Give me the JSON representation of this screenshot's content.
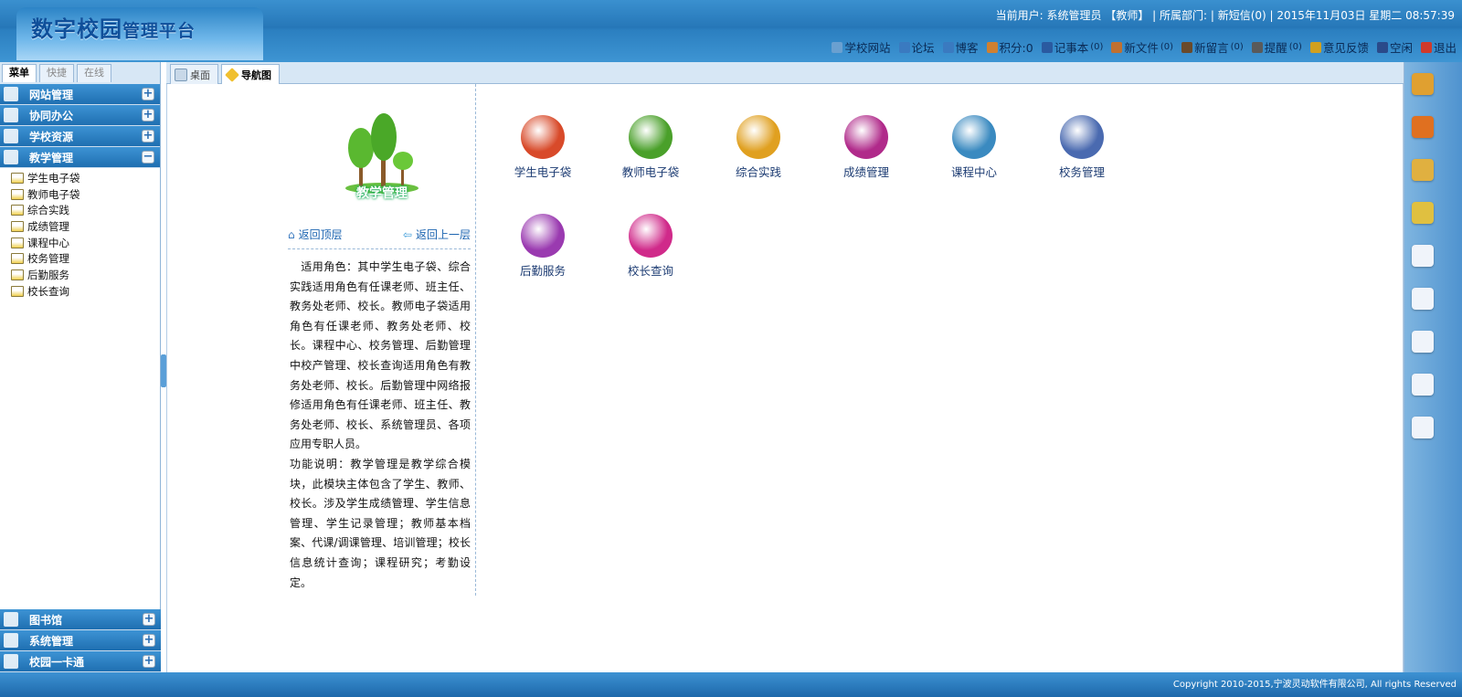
{
  "header": {
    "logo_main": "数字校园",
    "logo_sub": "管理平台",
    "status": "当前用户: 系统管理员 【教师】 | 所属部门: | 新短信(0) | 2015年11月03日 星期二 08:57:39",
    "toolbar": [
      {
        "label": "学校网站",
        "count": "",
        "icon": "monitor-icon",
        "color": "#6aa0d0"
      },
      {
        "label": "论坛",
        "count": "",
        "icon": "forum-icon",
        "color": "#3a7ac0"
      },
      {
        "label": "博客",
        "count": "",
        "icon": "blog-icon",
        "color": "#3a7ac0"
      },
      {
        "label": "积分:0",
        "count": "",
        "icon": "chart-icon",
        "color": "#d08030"
      },
      {
        "label": "记事本",
        "count": "(0)",
        "icon": "notebook-icon",
        "color": "#2a5aa0"
      },
      {
        "label": "新文件",
        "count": "(0)",
        "icon": "file-icon",
        "color": "#c07030"
      },
      {
        "label": "新留言",
        "count": "(0)",
        "icon": "message-icon",
        "color": "#6a4a2a"
      },
      {
        "label": "提醒",
        "count": "(0)",
        "icon": "alert-icon",
        "color": "#5a5a5a"
      },
      {
        "label": "意见反馈",
        "count": "",
        "icon": "feedback-icon",
        "color": "#d0a020"
      },
      {
        "label": "空闲",
        "count": "",
        "icon": "user-status-icon",
        "color": "#2a4a8a"
      },
      {
        "label": "退出",
        "count": "",
        "icon": "logout-icon",
        "color": "#d03a2a"
      }
    ]
  },
  "sidebar": {
    "tabs": [
      "菜单",
      "快捷",
      "在线"
    ],
    "categories_top": [
      {
        "label": "网站管理",
        "toggle": "+"
      },
      {
        "label": "协同办公",
        "toggle": "+"
      },
      {
        "label": "学校资源",
        "toggle": "+"
      },
      {
        "label": "教学管理",
        "toggle": "−"
      }
    ],
    "items": [
      "学生电子袋",
      "教师电子袋",
      "综合实践",
      "成绩管理",
      "课程中心",
      "校务管理",
      "后勤服务",
      "校长查询"
    ],
    "categories_bottom": [
      {
        "label": "图书馆",
        "toggle": "+"
      },
      {
        "label": "系统管理",
        "toggle": "+"
      },
      {
        "label": "校园一卡通",
        "toggle": "+"
      }
    ]
  },
  "tabs": [
    {
      "label": "桌面"
    },
    {
      "label": "导航图"
    }
  ],
  "module": {
    "title": "教学管理",
    "nav_top": "返回顶层",
    "nav_up": "返回上一层",
    "description": "　适用角色：其中学生电子袋、综合实践适用角色有任课老师、班主任、教务处老师、校长。教师电子袋适用角色有任课老师、教务处老师、校长。课程中心、校务管理、后勤管理中校产管理、校长查询适用角色有教务处老师、校长。后勤管理中网络报修适用角色有任课老师、班主任、教务处老师、校长、系统管理员、各项应用专职人员。",
    "function": "功能说明：教学管理是教学综合模块，此模块主体包含了学生、教师、校长。涉及学生成绩管理、学生信息管理、学生记录管理；教师基本档案、代课/调课管理、培训管理；校长信息统计查询；课程研究；考勤设定。"
  },
  "apps": [
    {
      "label": "学生电子袋",
      "icon": "student-bag-icon",
      "color": "#d84a2a"
    },
    {
      "label": "教师电子袋",
      "icon": "teacher-bag-icon",
      "color": "#4aa02a"
    },
    {
      "label": "综合实践",
      "icon": "globe-icon",
      "color": "#e0a020"
    },
    {
      "label": "成绩管理",
      "icon": "folders-icon",
      "color": "#b02a8a"
    },
    {
      "label": "课程中心",
      "icon": "course-icon",
      "color": "#3a8ac0"
    },
    {
      "label": "校务管理",
      "icon": "books-icon",
      "color": "#4a6ab0"
    },
    {
      "label": "后勤服务",
      "icon": "tools-icon",
      "color": "#9a3ab0"
    },
    {
      "label": "校长查询",
      "icon": "principal-search-icon",
      "color": "#d02a8a"
    }
  ],
  "right_bar": [
    {
      "icon": "books-icon",
      "color": "#e0a030"
    },
    {
      "icon": "eraser-icon",
      "color": "#e07020"
    },
    {
      "icon": "pencil-icon",
      "color": "#e0b040"
    },
    {
      "icon": "key-icon",
      "color": "#e0c040"
    },
    {
      "icon": "user-icon",
      "color": "#f0f4fa"
    },
    {
      "icon": "document-icon",
      "color": "#f0f4fa"
    },
    {
      "icon": "download-icon",
      "color": "#f0f4fa"
    },
    {
      "icon": "printer-icon",
      "color": "#f0f4fa"
    },
    {
      "icon": "settings-icon",
      "color": "#f0f4fa"
    }
  ],
  "footer": {
    "copyright": "Copyright 2010-2015,宁波灵动软件有限公司, All rights Reserved"
  }
}
